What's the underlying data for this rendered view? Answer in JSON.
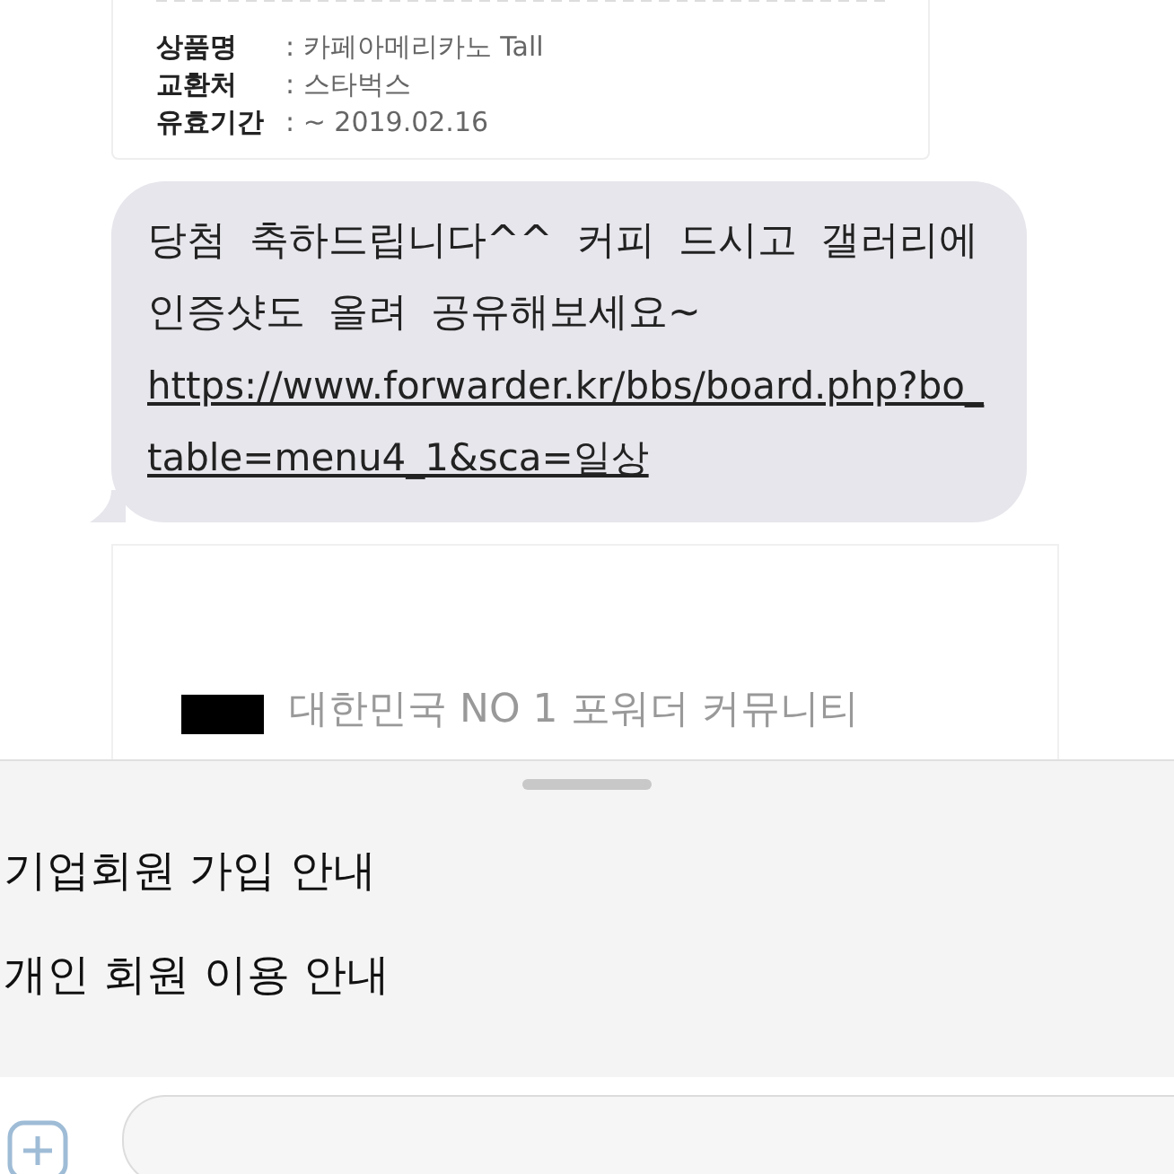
{
  "gift_card": {
    "rows": [
      {
        "label": "상품명",
        "value": ": 카페아메리카노 Tall"
      },
      {
        "label": "교환처",
        "value": ": 스타벅스"
      },
      {
        "label": "유효기간",
        "value": ": ~ 2019.02.16"
      }
    ]
  },
  "message": {
    "text": "당첨 축하드립니다^^ 커피 드시고 갤러리에 인증샷도 올려 공유해보세요~",
    "link": "https://www.forwarder.kr/bbs/board.php?bo_table=menu4_1&sca=일상"
  },
  "link_preview": {
    "title": "대한민국 NO 1 포워더 커뮤니티"
  },
  "menu": {
    "items": [
      "기업회원 가입 안내",
      "개인 회원 이용 안내"
    ]
  }
}
